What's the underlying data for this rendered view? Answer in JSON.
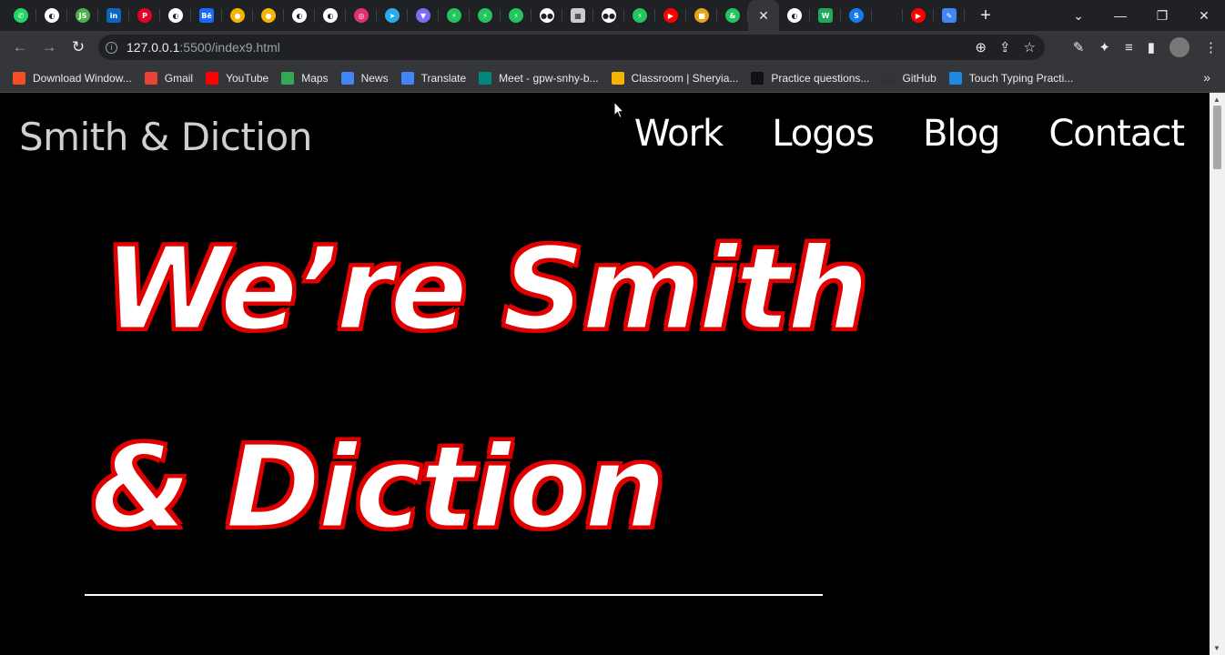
{
  "browser": {
    "tabs": [
      {
        "icon": "whatsapp-icon",
        "glyph": "✆",
        "color": "#25d366"
      },
      {
        "icon": "globe-icon",
        "glyph": "◐",
        "color": "#ffffff"
      },
      {
        "icon": "js-icon",
        "glyph": "JS",
        "color": "#4caf50"
      },
      {
        "icon": "linkedin-icon",
        "glyph": "in",
        "color": "#0a66c2"
      },
      {
        "icon": "pinterest-icon",
        "glyph": "P",
        "color": "#e60023"
      },
      {
        "icon": "globe-icon",
        "glyph": "◐",
        "color": "#ffffff"
      },
      {
        "icon": "behance-icon",
        "glyph": "Bē",
        "color": "#1769ff"
      },
      {
        "icon": "classroom-icon",
        "glyph": "●",
        "color": "#f4b400"
      },
      {
        "icon": "classroom-icon",
        "glyph": "●",
        "color": "#f4b400"
      },
      {
        "icon": "globe-icon",
        "glyph": "◐",
        "color": "#ffffff"
      },
      {
        "icon": "globe-icon",
        "glyph": "◐",
        "color": "#ffffff"
      },
      {
        "icon": "instagram-icon",
        "glyph": "◎",
        "color": "#e1306c"
      },
      {
        "icon": "telegram-icon",
        "glyph": "➤",
        "color": "#2aabee"
      },
      {
        "icon": "shield-icon",
        "glyph": "▼",
        "color": "#7b6cf6"
      },
      {
        "icon": "bolt-icon",
        "glyph": "⚡",
        "color": "#22c55e"
      },
      {
        "icon": "bolt-icon",
        "glyph": "⚡",
        "color": "#22c55e"
      },
      {
        "icon": "bolt-icon",
        "glyph": "⚡",
        "color": "#22c55e"
      },
      {
        "icon": "medium-icon",
        "glyph": "●●",
        "color": "#ffffff"
      },
      {
        "icon": "grid-icon",
        "glyph": "▦",
        "color": "#cccccc"
      },
      {
        "icon": "medium-icon",
        "glyph": "●●",
        "color": "#ffffff"
      },
      {
        "icon": "bolt-icon",
        "glyph": "⚡",
        "color": "#22c55e"
      },
      {
        "icon": "youtube-icon",
        "glyph": "▶",
        "color": "#ff0000"
      },
      {
        "icon": "colorful-icon",
        "glyph": "■",
        "color": "#e8a317"
      },
      {
        "icon": "ampersand-icon",
        "glyph": "&",
        "color": "#22c55e"
      },
      {
        "icon": "close-icon",
        "glyph": "✕",
        "color": "#e8eaed",
        "active": true
      },
      {
        "icon": "globe-icon",
        "glyph": "◐",
        "color": "#ffffff"
      },
      {
        "icon": "w-icon",
        "glyph": "W",
        "color": "#1faa59"
      },
      {
        "icon": "s-icon",
        "glyph": "S",
        "color": "#1877f2"
      },
      {
        "icon": "blank-icon",
        "glyph": "",
        "color": "#202124"
      },
      {
        "icon": "youtube-icon",
        "glyph": "▶",
        "color": "#ff0000"
      },
      {
        "icon": "docs-icon",
        "glyph": "✎",
        "color": "#4285f4"
      }
    ],
    "new_tab": "+",
    "url_host": "127.0.0.1",
    "url_rest": ":5500/index9.html",
    "bookmarks": [
      {
        "label": "Download Window...",
        "color": "#f25022"
      },
      {
        "label": "Gmail",
        "color": "#ea4335"
      },
      {
        "label": "YouTube",
        "color": "#ff0000"
      },
      {
        "label": "Maps",
        "color": "#34a853"
      },
      {
        "label": "News",
        "color": "#4285f4"
      },
      {
        "label": "Translate",
        "color": "#4285f4"
      },
      {
        "label": "Meet - gpw-snhy-b...",
        "color": "#00897b"
      },
      {
        "label": "Classroom | Sheryia...",
        "color": "#f4b400"
      },
      {
        "label": "Practice questions...",
        "color": "#111111"
      },
      {
        "label": "GitHub",
        "color": "#333333"
      },
      {
        "label": "Touch Typing Practi...",
        "color": "#1e88e5"
      }
    ],
    "bookmarks_more": "»"
  },
  "site": {
    "logo": "Smith & Diction",
    "nav": [
      "Work",
      "Logos",
      "Blog",
      "Contact"
    ],
    "hero_line1": "We’re Smith",
    "hero_line2": "& Diction"
  }
}
